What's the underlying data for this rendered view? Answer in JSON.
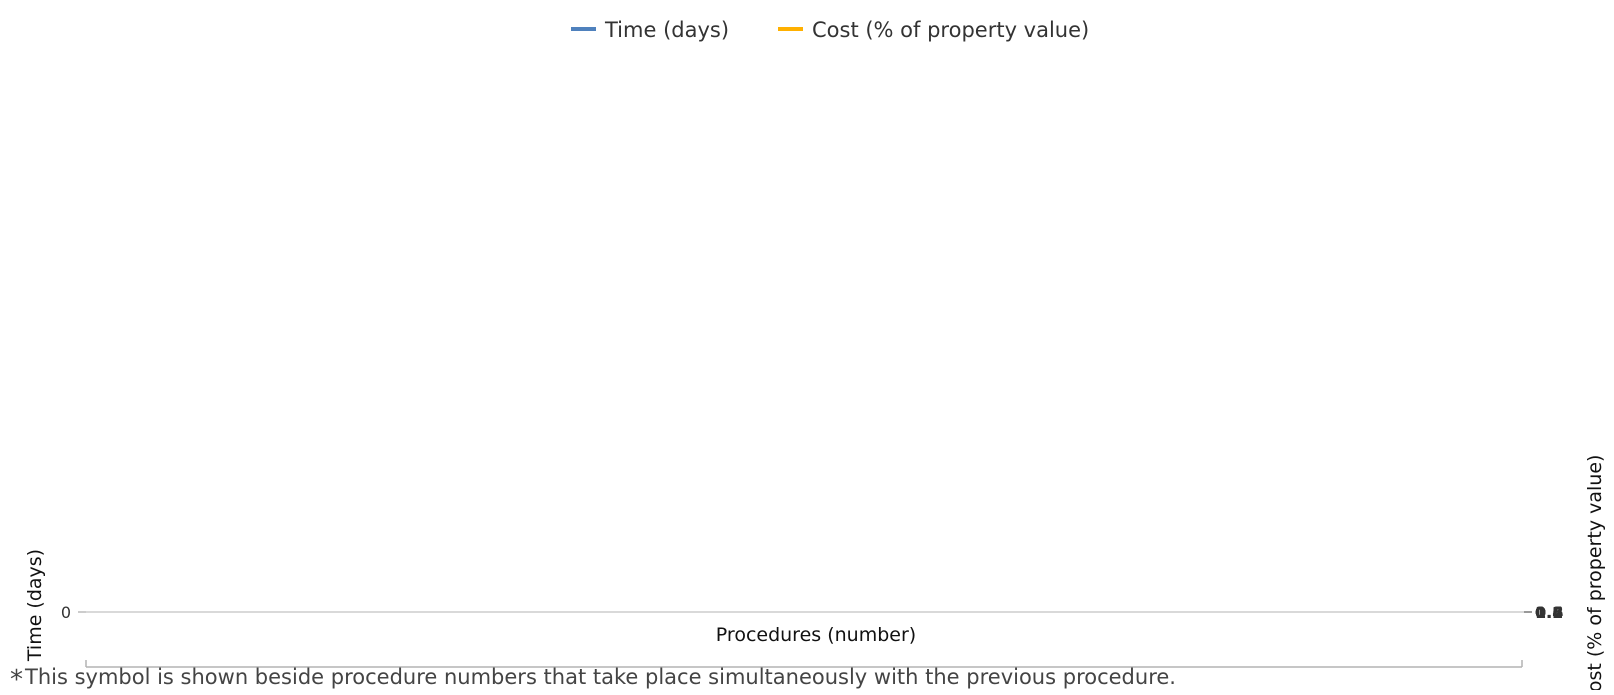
{
  "chart_data": {
    "type": "line",
    "categories": [],
    "series": [
      {
        "name": "Time (days)",
        "values": [],
        "color": "#4f81bd",
        "axis": "left"
      },
      {
        "name": "Cost (% of property value)",
        "values": [],
        "color": "#ffb000",
        "axis": "right"
      }
    ],
    "title": "",
    "xlabel": "Procedures (number)",
    "ylabel": "Time (days)",
    "y2label": "Cost (% of property value)",
    "left_ticks": [
      "0"
    ],
    "right_ticks": [
      "0",
      "0.2",
      "0.4",
      "0.6",
      "0.8",
      "1"
    ],
    "ylim": [
      0,
      0
    ],
    "y2lim": [
      0,
      1
    ],
    "legend": "top-center",
    "grid": false
  },
  "footnote": {
    "symbol": "*",
    "text": "This symbol is shown beside procedure numbers that take place simultaneously with the previous procedure."
  }
}
